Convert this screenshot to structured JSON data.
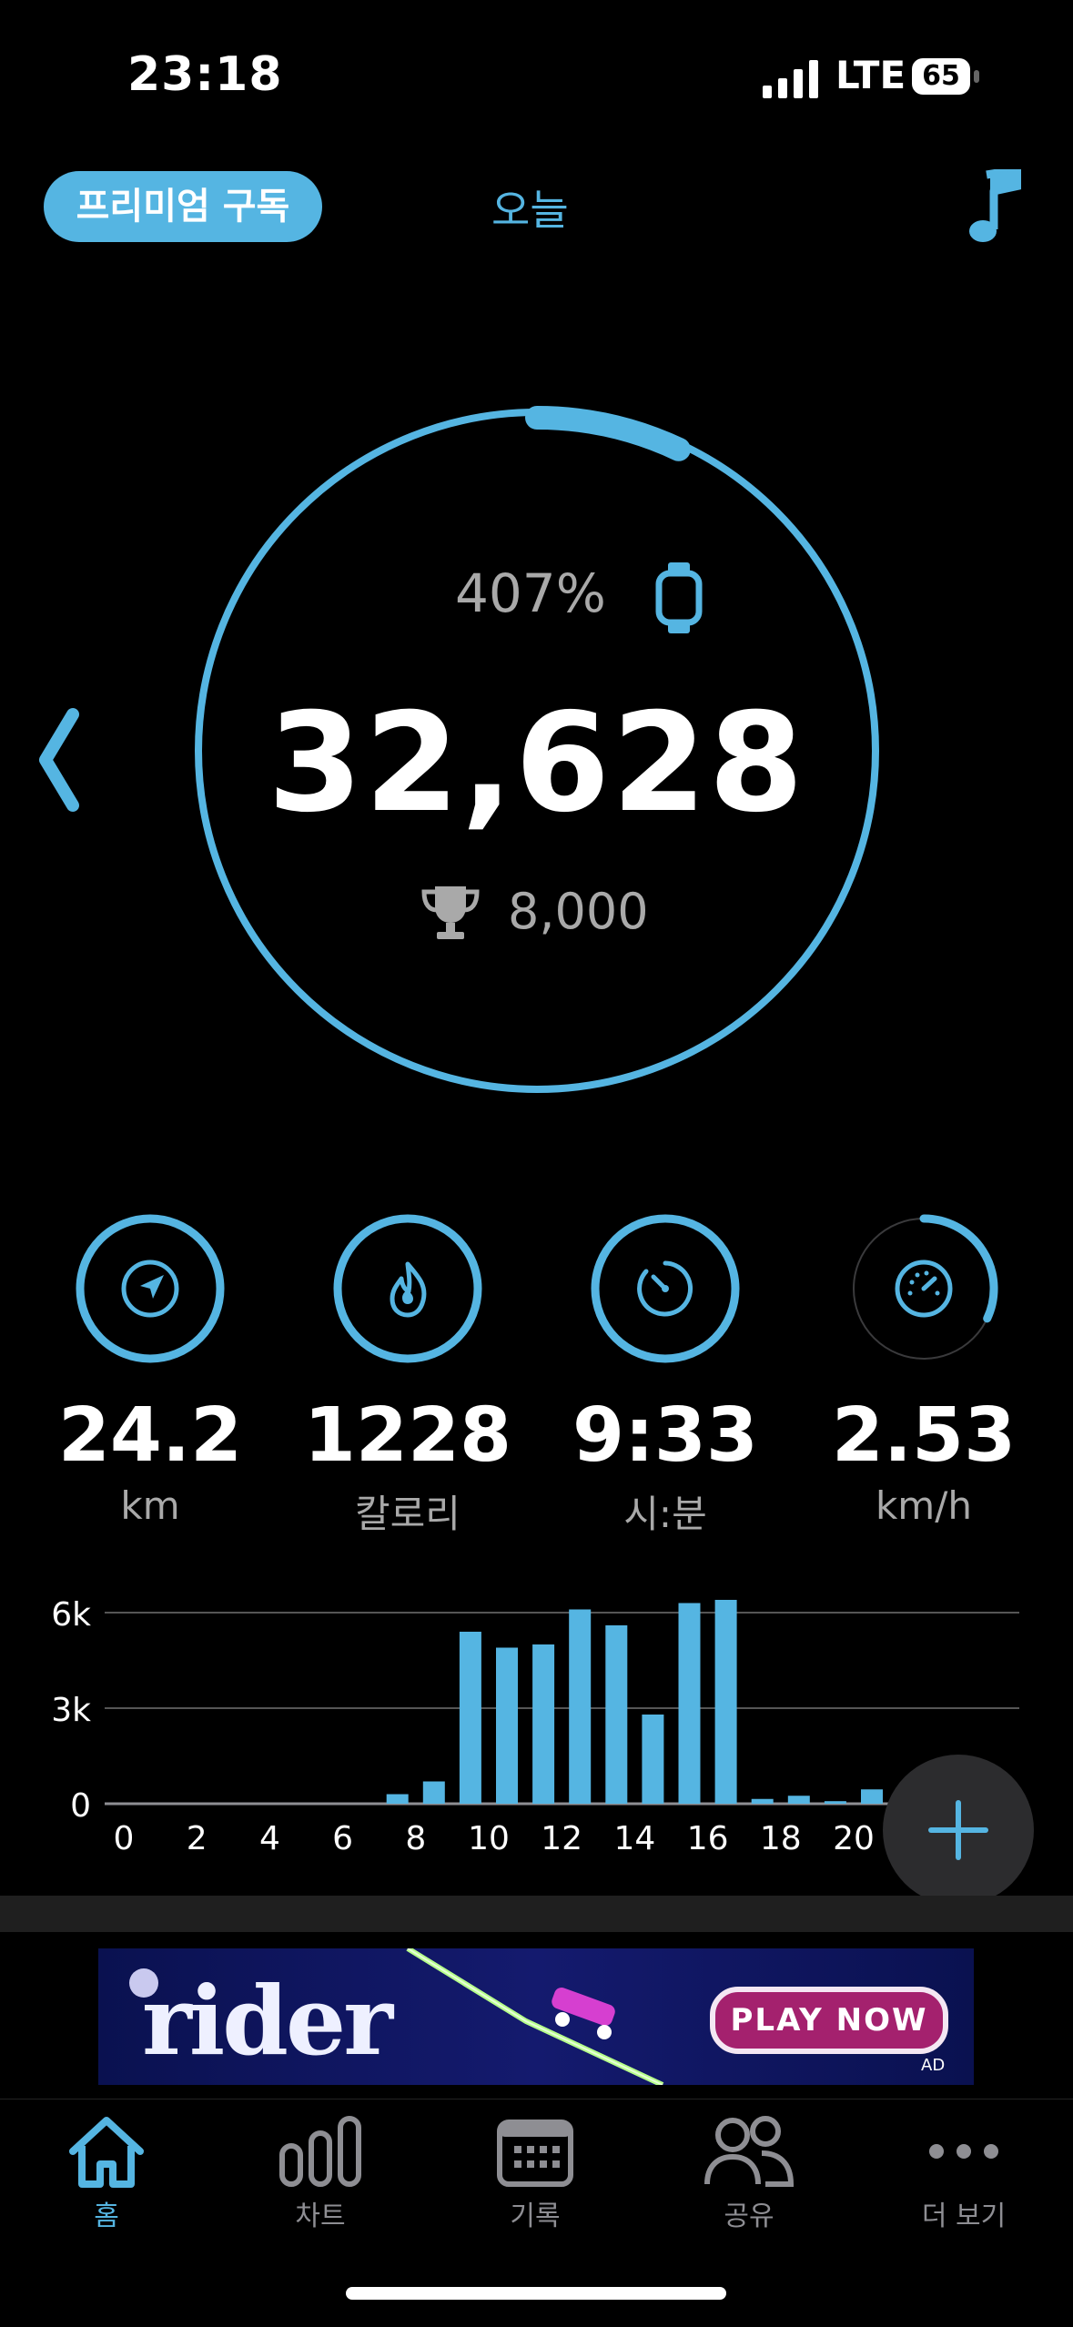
{
  "status_bar": {
    "time": "23:18",
    "network": "LTE",
    "battery": "65"
  },
  "top_bar": {
    "premium_label": "프리미엄 구독",
    "title": "오늘"
  },
  "summary": {
    "percent": "407%",
    "steps": "32,628",
    "goal": "8,000",
    "progress": 4.07
  },
  "stats": [
    {
      "value": "24.2",
      "unit": "km",
      "icon": "navigation-arrow-icon"
    },
    {
      "value": "1228",
      "unit": "칼로리",
      "icon": "flame-icon"
    },
    {
      "value": "9:33",
      "unit": "시:분",
      "icon": "timer-icon"
    },
    {
      "value": "2.53",
      "unit": "km/h",
      "icon": "speedometer-icon",
      "progress": 0.32
    }
  ],
  "chart_data": {
    "type": "bar",
    "x": [
      0,
      1,
      2,
      3,
      4,
      5,
      6,
      7,
      8,
      9,
      10,
      11,
      12,
      13,
      14,
      15,
      16,
      17,
      18,
      19,
      20,
      21,
      22,
      23
    ],
    "values": [
      0,
      0,
      0,
      0,
      0,
      0,
      0,
      300,
      700,
      5400,
      4900,
      5000,
      6100,
      5600,
      2800,
      6300,
      6400,
      150,
      250,
      80,
      450,
      0,
      0,
      0
    ],
    "xticks": [
      "0",
      "2",
      "4",
      "6",
      "8",
      "10",
      "12",
      "14",
      "16",
      "18",
      "20"
    ],
    "yticks": [
      "0",
      "3k",
      "6k"
    ],
    "ylim": [
      0,
      8000
    ],
    "bar_color": "#55b5e2",
    "grid": true
  },
  "ad": {
    "brand": "rider",
    "cta": "PLAY NOW",
    "tag": "AD"
  },
  "tabs": [
    {
      "label": "홈",
      "icon": "home-icon",
      "active": true
    },
    {
      "label": "차트",
      "icon": "bar-chart-icon",
      "active": false
    },
    {
      "label": "기록",
      "icon": "calendar-icon",
      "active": false
    },
    {
      "label": "공유",
      "icon": "people-icon",
      "active": false
    },
    {
      "label": "더 보기",
      "icon": "more-icon",
      "active": false
    }
  ],
  "colors": {
    "accent": "#55b5e2",
    "muted": "#a9a9a9",
    "background": "#000000"
  }
}
